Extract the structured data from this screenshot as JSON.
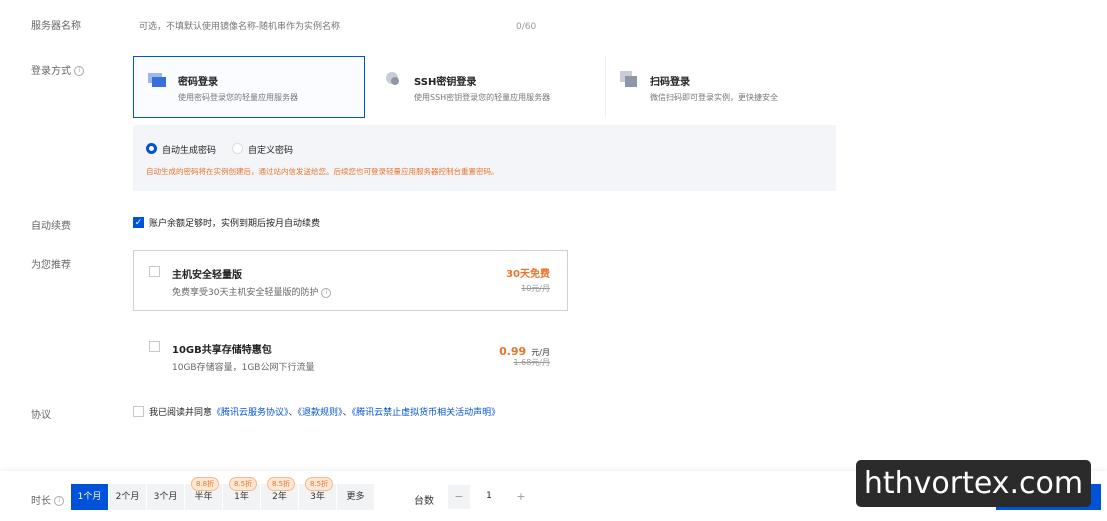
{
  "form": {
    "server_name_label": "服务器名称",
    "server_name_placeholder": "可选，不填默认使用镜像名称-随机串作为实例名称",
    "server_name_counter": "0/60",
    "login_label": "登录方式",
    "login_options": [
      {
        "title": "密码登录",
        "desc": "使用密码登录您的轻量应用服务器",
        "selected": true
      },
      {
        "title": "SSH密钥登录",
        "desc": "使用SSH密钥登录您的轻量应用服务器",
        "selected": false
      },
      {
        "title": "扫码登录",
        "desc": "微信扫码即可登录实例，更快捷安全",
        "selected": false
      }
    ],
    "password_options": {
      "auto": "自动生成密码",
      "custom": "自定义密码",
      "note": "自动生成的密码将在实例创建后，通过站内信发送给您。后续您也可登录轻量应用服务器控制台重置密码。"
    },
    "auto_renew_label": "自动续费",
    "auto_renew_text": "账户余额足够时，实例到期后按月自动续费",
    "recommend_label": "为您推荐",
    "recommendations": [
      {
        "title": "主机安全轻量版",
        "desc": "免费享受30天主机安全轻量版的防护",
        "price": "30天免费",
        "unit": "",
        "orig": "10元/月"
      },
      {
        "title": "10GB共享存储特惠包",
        "desc": "10GB存储容量，1GB公网下行流量",
        "price": "0.99",
        "unit": "元/月",
        "orig": "1.68元/月"
      }
    ],
    "agreement_label": "协议",
    "agreement_prefix": "我已阅读并同意",
    "agreement_link1": "《腾讯云服务协议》",
    "agreement_link2": "《退款规则》",
    "agreement_link3": "《腾讯云禁止虚拟货币相关活动声明》",
    "sep": "、"
  },
  "bottom": {
    "duration_label": "时长",
    "durations": [
      "1个月",
      "2个月",
      "3个月",
      "半年",
      "1年",
      "2年",
      "3年",
      "更多"
    ],
    "selected_duration": "1个月",
    "discounts": {
      "half_year": "8.8折",
      "one_year": "8.5折",
      "two_year": "8.5折",
      "three_year": "8.5折"
    },
    "qty_label": "台数",
    "qty_minus": "−",
    "qty_value": "1",
    "qty_plus": "+",
    "watermark": "hthvortex.com"
  },
  "colors": {
    "accent": "#0052d9",
    "warning": "#e8742c"
  }
}
